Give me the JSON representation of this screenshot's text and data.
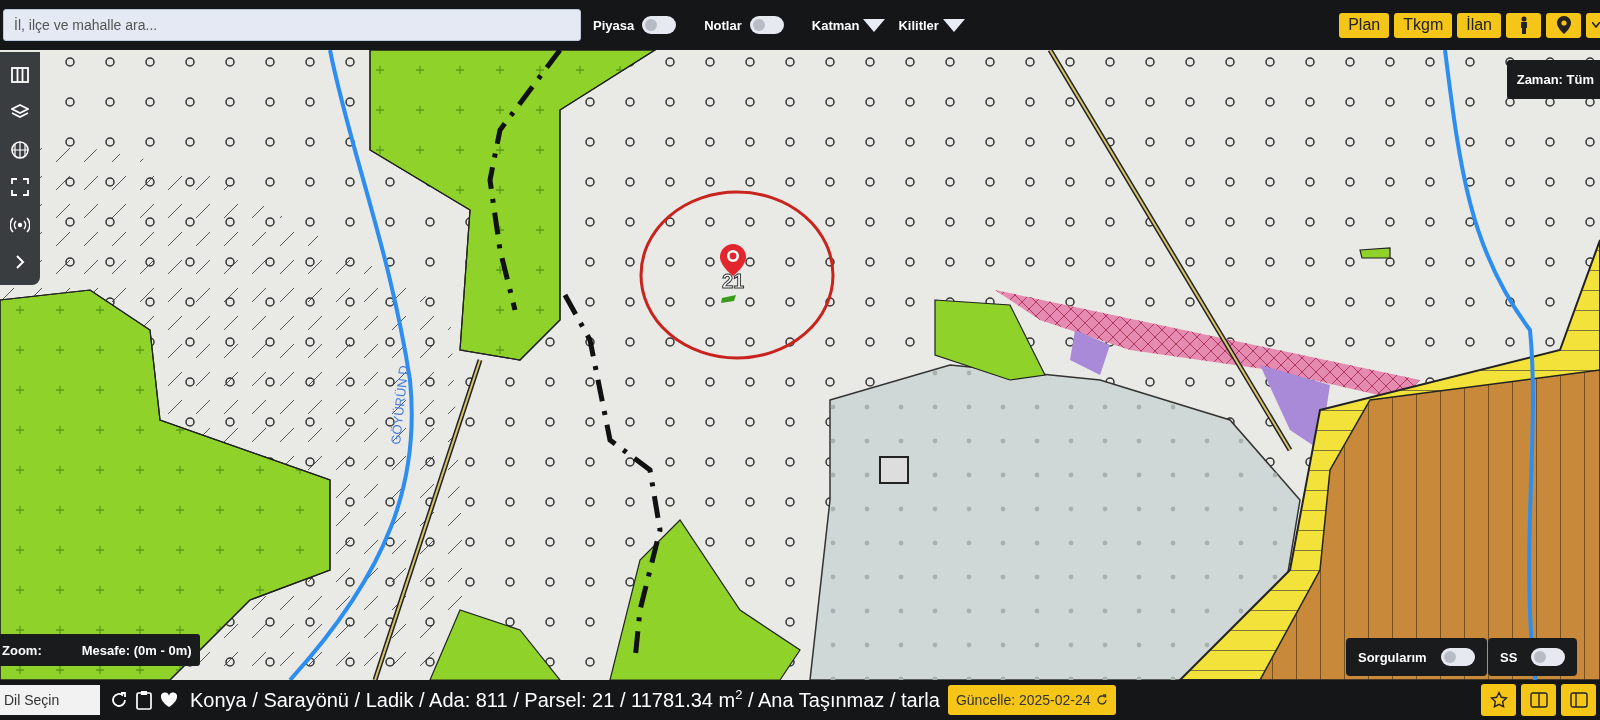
{
  "search": {
    "placeholder": "İl, ilçe ve mahalle ara..."
  },
  "toggles": [
    {
      "label": "Piyasa",
      "on": false
    },
    {
      "label": "Notlar",
      "on": false
    }
  ],
  "dropdowns": [
    {
      "label": "Katman"
    },
    {
      "label": "Kilitler"
    }
  ],
  "top_buttons": [
    {
      "label": "Plan"
    },
    {
      "label": "Tkgm"
    },
    {
      "label": "İlan"
    }
  ],
  "map": {
    "time_filter": "Zaman: Tüm",
    "parcel_label": "21",
    "river_label": "GÖYÜRÜN D.",
    "measure": {
      "zoom": "Zoom:",
      "distance": "Mesafe: (0m - 0m)"
    },
    "panel_toggles": [
      {
        "label": "Sorgularım",
        "on": false
      },
      {
        "label": "SS",
        "on": false
      }
    ]
  },
  "status_bar": {
    "language": "Dil Seçin",
    "breadcrumb": "Konya / Sarayönü / Ladik / Ada: 811 / Parsel: 21 / 11781.34 m$^{2}$ / Ana Taşınmaz / tarla",
    "update_button": "Güncelle: 2025-02-24"
  }
}
